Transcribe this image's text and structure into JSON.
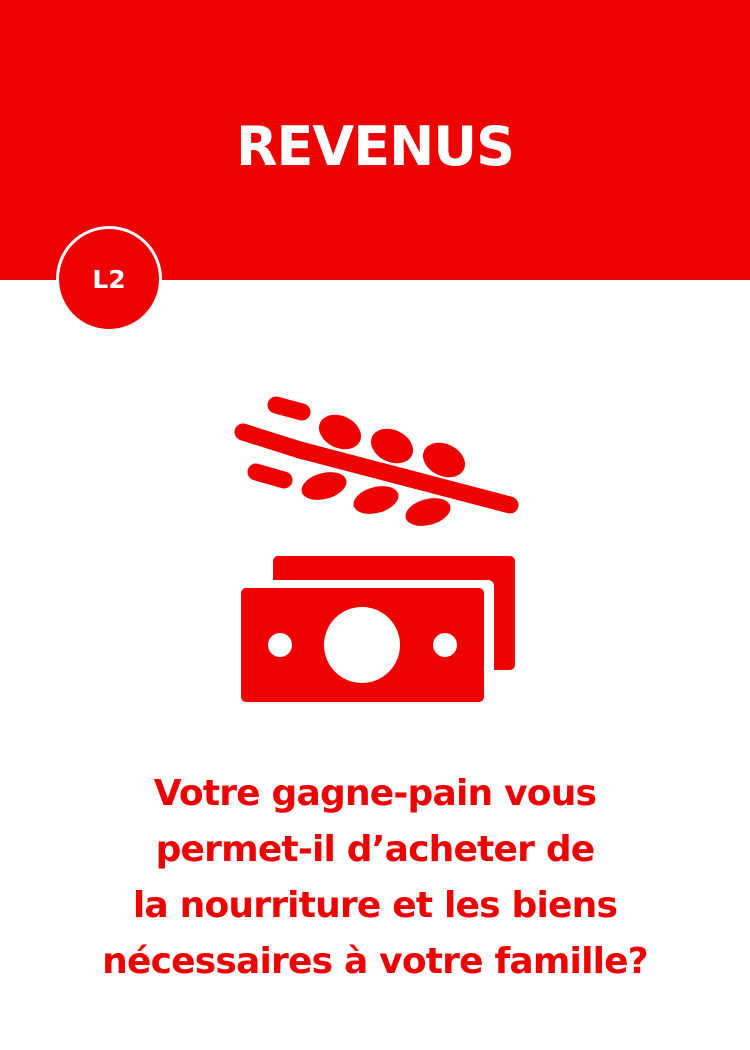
{
  "card": {
    "title": "REVENUS",
    "badge": "L2",
    "icon": "wheat-and-banknotes-icon",
    "question": "Votre gagne-pain vous\npermet-il d’acheter de\nla nourriture et les biens\nnécessaires à votre famille?"
  },
  "colors": {
    "accent": "#ee0000",
    "background": "#ffffff"
  }
}
